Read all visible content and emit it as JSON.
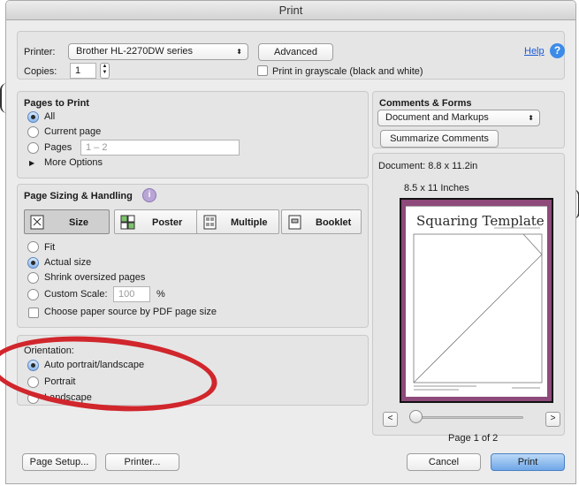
{
  "window": {
    "title": "Print"
  },
  "printer": {
    "label": "Printer:",
    "selected": "Brother HL-2270DW series",
    "advanced": "Advanced",
    "help": "Help",
    "help_icon": "?"
  },
  "copies": {
    "label": "Copies:",
    "value": "1",
    "grayscale": "Print in grayscale (black and white)"
  },
  "pages_to_print": {
    "title": "Pages to Print",
    "all": "All",
    "current": "Current page",
    "pages": "Pages",
    "range_placeholder": "1 – 2",
    "more": "More Options"
  },
  "comments": {
    "title": "Comments & Forms",
    "selected": "Document and Markups",
    "summarize": "Summarize Comments"
  },
  "page_sizing": {
    "title": "Page Sizing & Handling",
    "info_icon": "i",
    "modes": [
      "Size",
      "Poster",
      "Multiple",
      "Booklet"
    ],
    "fit": "Fit",
    "actual": "Actual size",
    "shrink": "Shrink oversized pages",
    "custom": "Custom Scale:",
    "custom_value": "100",
    "percent": "%",
    "paper_source": "Choose paper source by PDF page size"
  },
  "orientation": {
    "title": "Orientation:",
    "auto": "Auto portrait/landscape",
    "portrait": "Portrait",
    "landscape": "Landscape"
  },
  "preview": {
    "document": "Document: 8.8 x 11.2in",
    "paper": "8.5 x 11 Inches",
    "doc_title": "Squaring Template",
    "page_info": "Page 1 of 2",
    "prev": "<",
    "next": ">"
  },
  "footer": {
    "page_setup": "Page Setup...",
    "printer": "Printer...",
    "cancel": "Cancel",
    "print": "Print"
  },
  "colors": {
    "accent": "#6fa7e8",
    "annotation": "#d0262c",
    "preview_border": "#8d4a7a"
  }
}
